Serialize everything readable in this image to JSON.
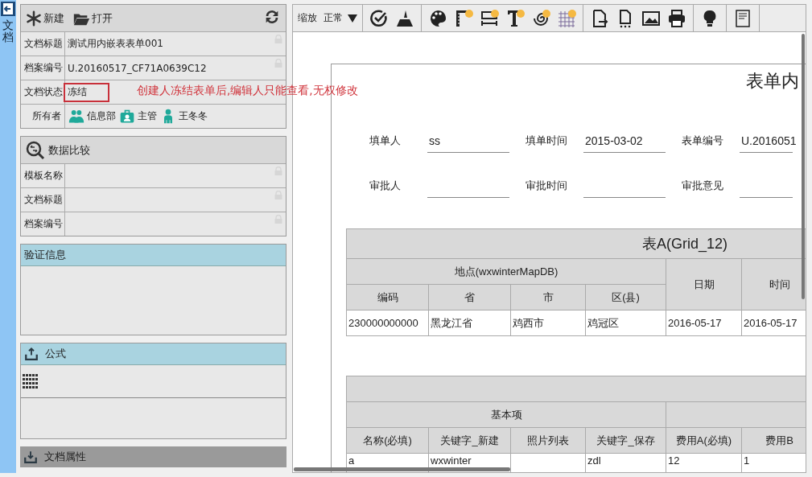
{
  "side_tab": {
    "label": "文档"
  },
  "doc_panel": {
    "actions": [
      {
        "kind": "new",
        "label": "新建"
      },
      {
        "kind": "open",
        "label": "打开"
      }
    ],
    "fields": [
      {
        "label": "文档标题",
        "value": "测试用内嵌表表单001",
        "locked": true
      },
      {
        "label": "档案编号",
        "value": "U.20160517_CF71A0639C12",
        "locked": true
      }
    ],
    "status": {
      "label": "文档状态",
      "value": "冻结",
      "highlighted": true
    },
    "owners": {
      "label": "所有者",
      "items": [
        {
          "kind": "group",
          "name": "信息部"
        },
        {
          "kind": "role",
          "name": "主管"
        },
        {
          "kind": "user",
          "name": "王冬冬"
        }
      ]
    }
  },
  "annotation": {
    "text": "创建人冻结表单后,编辑人只能查看,无权修改"
  },
  "compare_panel": {
    "title": "数据比较",
    "fields": [
      {
        "label": "模板名称",
        "locked": true
      },
      {
        "label": "文档标题",
        "locked": true
      },
      {
        "label": "档案编号",
        "locked": true
      }
    ]
  },
  "validation_panel": {
    "title": "验证信息",
    "expanded": true
  },
  "formula_panel": {
    "title": "公式",
    "expanded": true
  },
  "properties_panel": {
    "title": "文档属性",
    "expanded": false
  },
  "toolbar": {
    "zoom_label": "缩放",
    "zoom_value": "正常"
  },
  "form": {
    "title": "表单内",
    "fields": [
      [
        {
          "label": "填单人",
          "value": "ss"
        },
        {
          "label": "填单时间",
          "value": "2015-03-02"
        },
        {
          "label": "表单编号",
          "value": "U.2016051"
        }
      ],
      [
        {
          "label": "审批人"
        },
        {
          "label": "审批时间"
        },
        {
          "label": "审批意见"
        }
      ]
    ],
    "table_a": {
      "title": "表A(Grid_12)",
      "group": "地点(wxwinterMapDB)",
      "columns": [
        "编码",
        "省",
        "市",
        "区(县)",
        "日期",
        "时间"
      ],
      "rows": [
        [
          "230000000000",
          "黑龙江省",
          "鸡西市",
          "鸡冠区",
          "2016-05-17",
          "2016-05-17"
        ]
      ]
    },
    "table_b": {
      "group": "基本项",
      "columns": [
        "名称(必填)",
        "关键字_新建",
        "照片列表",
        "关键字_保存",
        "费用A(必填)",
        "费用B"
      ],
      "rows": [
        [
          "a",
          "wxwinter",
          "",
          "zdl",
          "12",
          "1"
        ]
      ]
    }
  }
}
